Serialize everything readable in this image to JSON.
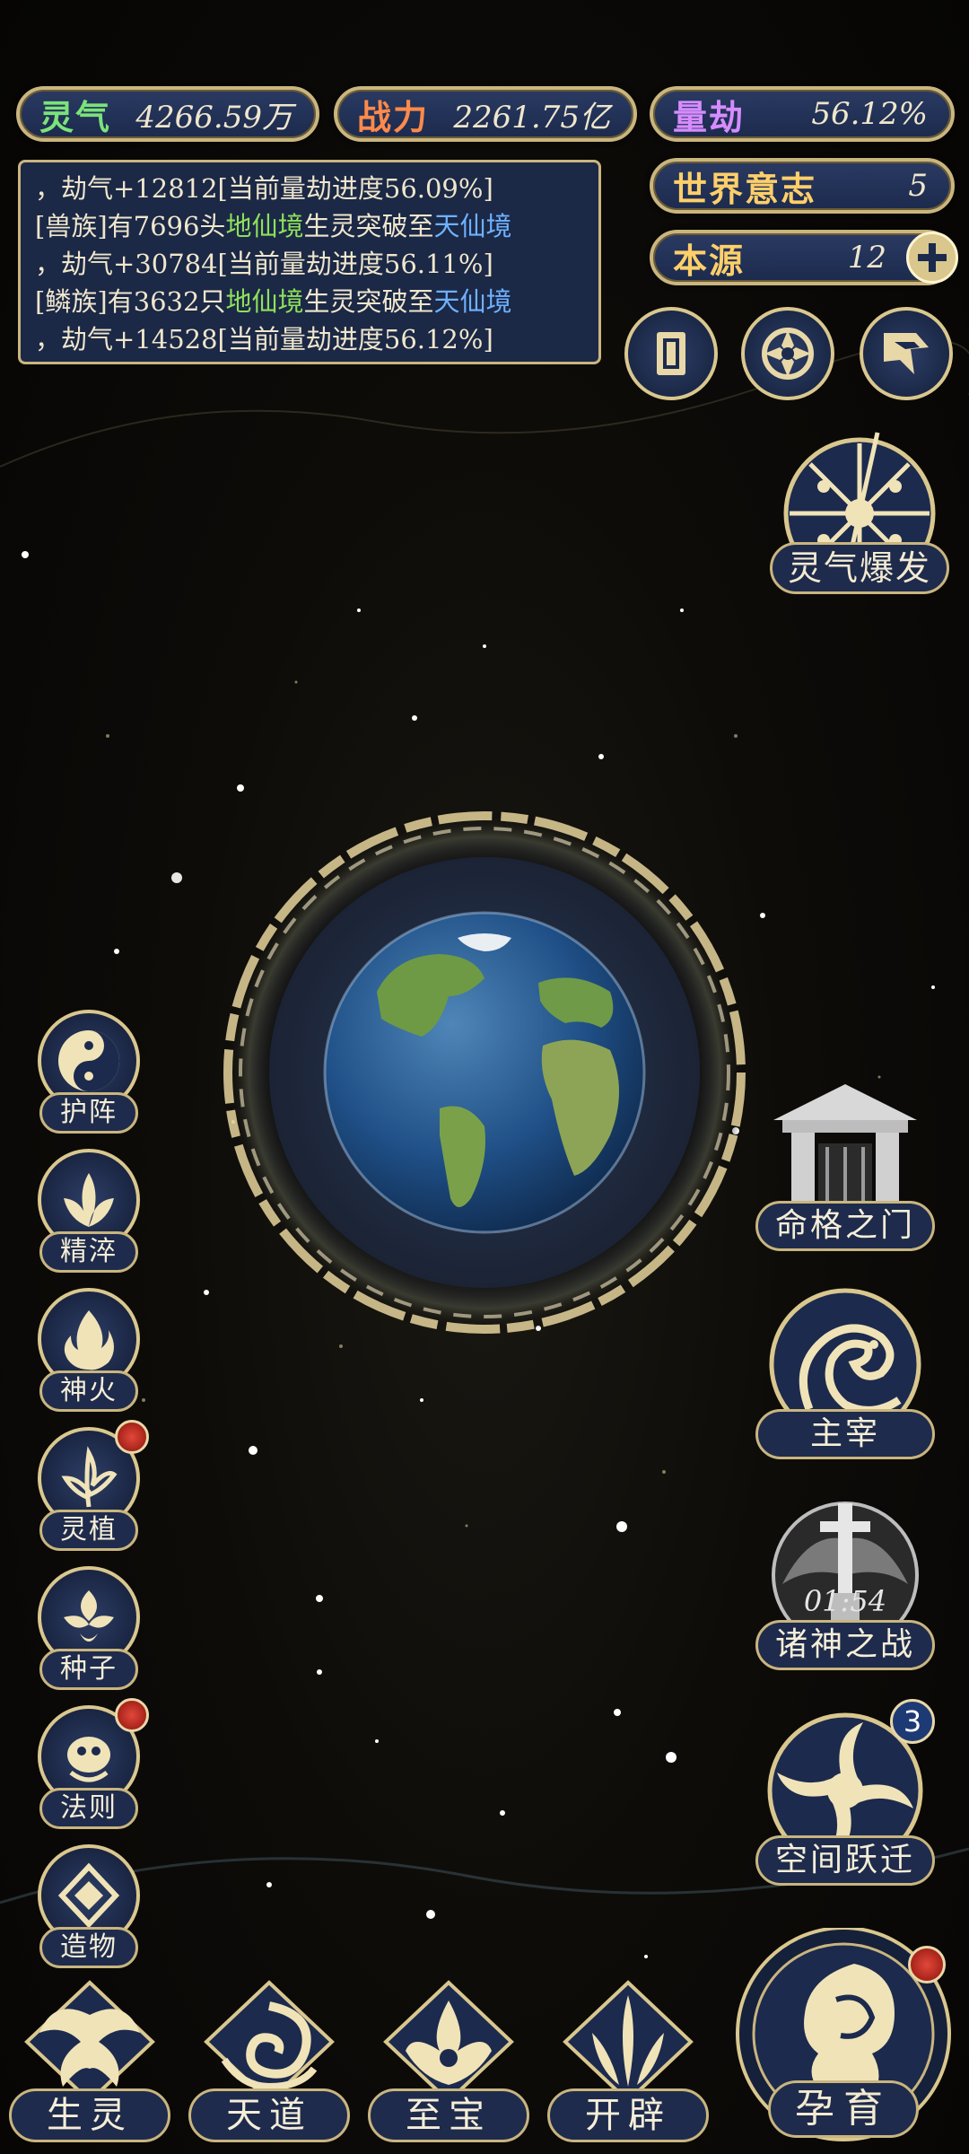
{
  "resources": {
    "lingqi": {
      "label": "灵气",
      "value": "4266.59万",
      "color": "#7be37a"
    },
    "zhanli": {
      "label": "战力",
      "value": "2261.75亿",
      "color": "#ff8a4a"
    },
    "liangjie": {
      "label": "量劫",
      "value": "56.12%",
      "color": "#d68cff"
    },
    "shijie": {
      "label": "世界意志",
      "value": "5",
      "color": "#ffcf6a"
    },
    "benyuan": {
      "label": "本源",
      "value": "12",
      "color": "#ffcf6a"
    }
  },
  "log": {
    "line1": "，劫气+12812[当前量劫进度56.09%]",
    "line2_prefix": "[兽族]有7696头",
    "line2_realm1": "地仙境",
    "line2_mid": "生灵突破至",
    "line2_realm2": "天仙境",
    "line3": "，劫气+30784[当前量劫进度56.11%]",
    "line4_prefix": "[鳞族]有3632只",
    "line4_realm1": "地仙境",
    "line4_mid": "生灵突破至",
    "line4_realm2": "天仙境",
    "line5": "，劫气+14528[当前量劫进度56.12%]"
  },
  "top_icons": [
    "card-icon",
    "portal-icon",
    "flag-icon"
  ],
  "burst": {
    "label": "灵气爆发"
  },
  "left_menu": [
    {
      "label": "护阵",
      "icon": "yinyang-icon",
      "dot": false
    },
    {
      "label": "精淬",
      "icon": "lotus-icon",
      "dot": false
    },
    {
      "label": "神火",
      "icon": "flame-icon",
      "dot": false
    },
    {
      "label": "灵植",
      "icon": "plant-icon",
      "dot": true
    },
    {
      "label": "种子",
      "icon": "seed-icon",
      "dot": false
    },
    {
      "label": "法则",
      "icon": "beast-icon",
      "dot": true
    },
    {
      "label": "造物",
      "icon": "crystal-icon",
      "dot": false
    }
  ],
  "right_menu": [
    {
      "label": "命格之门",
      "icon": "gate-icon"
    },
    {
      "label": "主宰",
      "icon": "dragon-icon"
    },
    {
      "label": "诸神之战",
      "icon": "sword-icon",
      "timer": "01:54"
    },
    {
      "label": "空间跃迁",
      "icon": "vortex-icon",
      "badge": "3"
    }
  ],
  "bottom_menu": [
    {
      "label": "生灵",
      "icon": "phoenix-icon"
    },
    {
      "label": "天道",
      "icon": "swirl-icon"
    },
    {
      "label": "至宝",
      "icon": "treasure-icon"
    },
    {
      "label": "开辟",
      "icon": "axe-icon"
    },
    {
      "label": "孕育",
      "icon": "embryo-icon",
      "dot": true
    }
  ]
}
